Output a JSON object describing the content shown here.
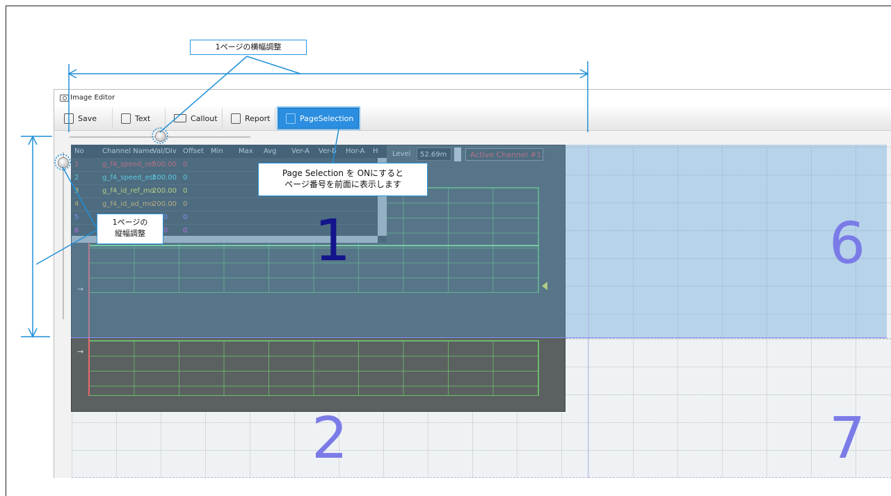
{
  "window": {
    "title": "Image Editor"
  },
  "toolbar": {
    "items": [
      {
        "label": "Save",
        "icon": "save-icon"
      },
      {
        "label": "Text",
        "icon": "text-icon"
      },
      {
        "label": "Callout",
        "icon": "callout-icon"
      },
      {
        "label": "Report",
        "icon": "report-icon"
      },
      {
        "label": "PageSelection",
        "icon": "page-selection-icon",
        "active": true
      }
    ]
  },
  "channel_table": {
    "headers": [
      "No",
      "Channel Name",
      "Val/Div",
      "Offset",
      "Min",
      "Max",
      "Avg",
      "Ver-A",
      "Ver-B",
      "Hor-A",
      "H"
    ],
    "rows": [
      {
        "no": "1",
        "name": "g_f4_speed_ref",
        "val_div": "500.00",
        "offset": "0",
        "color": "#e85a5a"
      },
      {
        "no": "2",
        "name": "g_f4_speed_est",
        "val_div": "500.00",
        "offset": "0",
        "color": "#5ee0e0"
      },
      {
        "no": "3",
        "name": "g_f4_id_ref_mo",
        "val_div": "200.00",
        "offset": "0",
        "color": "#e8e85a"
      },
      {
        "no": "4",
        "name": "g_f4_id_ad_mo",
        "val_div": "200.00",
        "offset": "0",
        "color": "#e8b45a"
      },
      {
        "no": "5",
        "name": "",
        "val_div": "0.00",
        "offset": "0",
        "color": "#8a8aff"
      },
      {
        "no": "6",
        "name": "",
        "val_div": "0.00",
        "offset": "0",
        "color": "#e85ae8"
      }
    ]
  },
  "trigger": {
    "level_label": "Level",
    "level_value": "52.69m",
    "active_channel": "Active Channel #1"
  },
  "page_numbers": [
    "1",
    "2",
    "6",
    "7"
  ],
  "callouts": {
    "width_adjust": "1ページの横幅調整",
    "height_adjust_line1": "1ページの",
    "height_adjust_line2": "縦幅調整",
    "page_selection_line1": "Page Selection を ONにすると",
    "page_selection_line2": "ページ番号を前面に表示します"
  },
  "colors": {
    "accent": "#2b8ee0",
    "annotation": "#1f8fd8",
    "page_number": "#7b7be8",
    "grid": "#6fc06f"
  }
}
